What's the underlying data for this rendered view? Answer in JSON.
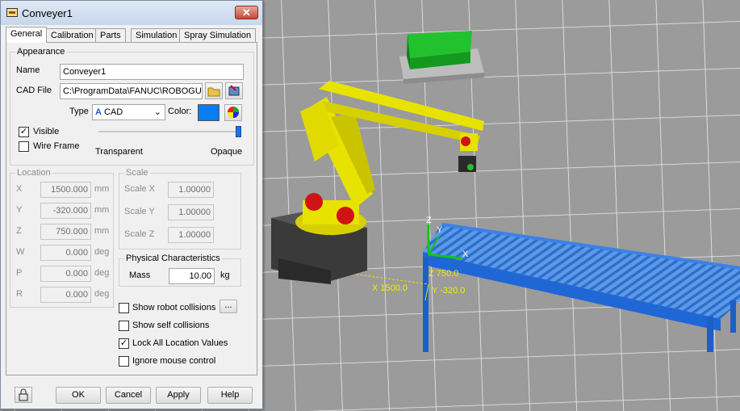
{
  "window": {
    "title": "Conveyer1"
  },
  "tabs": [
    "General",
    "Calibration",
    "Parts",
    "Simulation",
    "Spray Simulation"
  ],
  "appearance": {
    "group_label": "Appearance",
    "name_label": "Name",
    "name_value": "Conveyer1",
    "cad_label": "CAD File",
    "cad_value": "C:\\ProgramData\\FANUC\\ROBOGUID",
    "type_label": "Type",
    "type_value": "CAD",
    "color_label": "Color:",
    "color_value": "#0a7cf0",
    "visible_label": "Visible",
    "visible_checked": true,
    "wireframe_label": "Wire Frame",
    "wireframe_checked": false,
    "transparent_label": "Transparent",
    "opaque_label": "Opaque",
    "opacity_level": 1.0
  },
  "location": {
    "group_label": "Location",
    "rows": [
      {
        "label": "X",
        "value": "1500.000",
        "unit": "mm"
      },
      {
        "label": "Y",
        "value": "-320.000",
        "unit": "mm"
      },
      {
        "label": "Z",
        "value": "750.000",
        "unit": "mm"
      },
      {
        "label": "W",
        "value": "0.000",
        "unit": "deg"
      },
      {
        "label": "P",
        "value": "0.000",
        "unit": "deg"
      },
      {
        "label": "R",
        "value": "0.000",
        "unit": "deg"
      }
    ]
  },
  "scale": {
    "group_label": "Scale",
    "rows": [
      {
        "label": "Scale X",
        "value": "1.00000"
      },
      {
        "label": "Scale Y",
        "value": "1.00000"
      },
      {
        "label": "Scale Z",
        "value": "1.00000"
      }
    ]
  },
  "physical": {
    "group_label": "Physical Characteristics",
    "mass_label": "Mass",
    "mass_value": "10.00",
    "mass_unit": "kg"
  },
  "options": {
    "show_robot_collisions": "Show robot collisions",
    "show_self_collisions": "Show self collisions",
    "lock_all": "Lock All Location Values",
    "lock_all_checked": true,
    "ignore_mouse": "Ignore mouse control",
    "more_button": "..."
  },
  "footer": {
    "ok": "OK",
    "cancel": "Cancel",
    "apply": "Apply",
    "help": "Help"
  },
  "scene": {
    "frame_labels": {
      "z": "Z",
      "y": "Y",
      "x": "X"
    },
    "dim_x": "X 1500.0",
    "dim_z": "Z 750.0",
    "dim_y": "Y -320.0",
    "robot_color": "#e8e200",
    "conveyor_color": "#1e6fe0",
    "part_color": "#1fc12a"
  }
}
